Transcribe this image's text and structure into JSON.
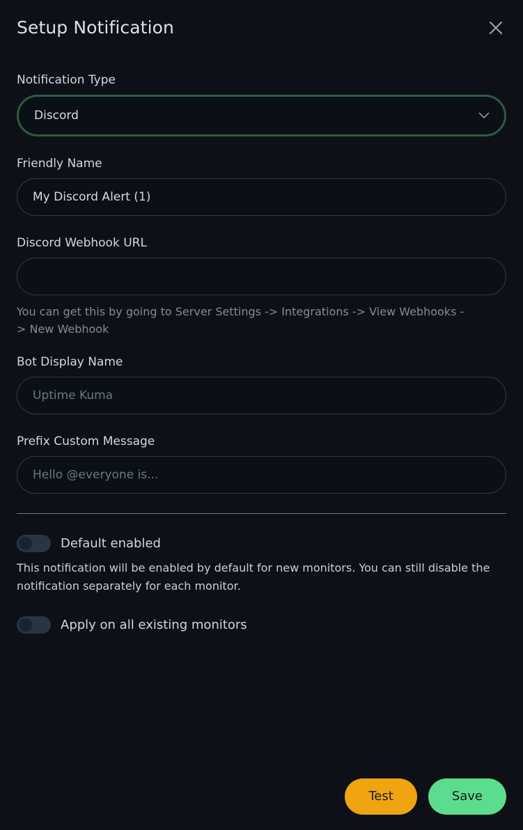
{
  "dialog": {
    "title": "Setup Notification",
    "close_icon": "close-icon"
  },
  "form": {
    "notification_type": {
      "label": "Notification Type",
      "value": "Discord",
      "chevron_icon": "chevron-down-icon"
    },
    "friendly_name": {
      "label": "Friendly Name",
      "value": "My Discord Alert (1)",
      "placeholder": ""
    },
    "webhook_url": {
      "label": "Discord Webhook URL",
      "value": "",
      "placeholder": "",
      "hint": "You can get this by going to Server Settings -> Integrations -> View Webhooks -> New Webhook"
    },
    "bot_display_name": {
      "label": "Bot Display Name",
      "value": "",
      "placeholder": "Uptime Kuma"
    },
    "prefix_custom_message": {
      "label": "Prefix Custom Message",
      "value": "",
      "placeholder": "Hello @everyone is..."
    }
  },
  "toggles": {
    "default_enabled": {
      "label": "Default enabled",
      "state": "off",
      "description": "This notification will be enabled by default for new monitors. You can still disable the notification separately for each monitor."
    },
    "apply_all": {
      "label": "Apply on all existing monitors",
      "state": "off"
    }
  },
  "footer": {
    "test_label": "Test",
    "save_label": "Save"
  },
  "colors": {
    "background": "#0d1117",
    "field_background": "#0b0f16",
    "field_border": "#343b47",
    "focus_ring_green": "#2e5b42",
    "test_button": "#f0a40f",
    "save_button": "#5cdd8d",
    "divider": "#6c7684",
    "toggle_track_off": "#2a3442"
  }
}
